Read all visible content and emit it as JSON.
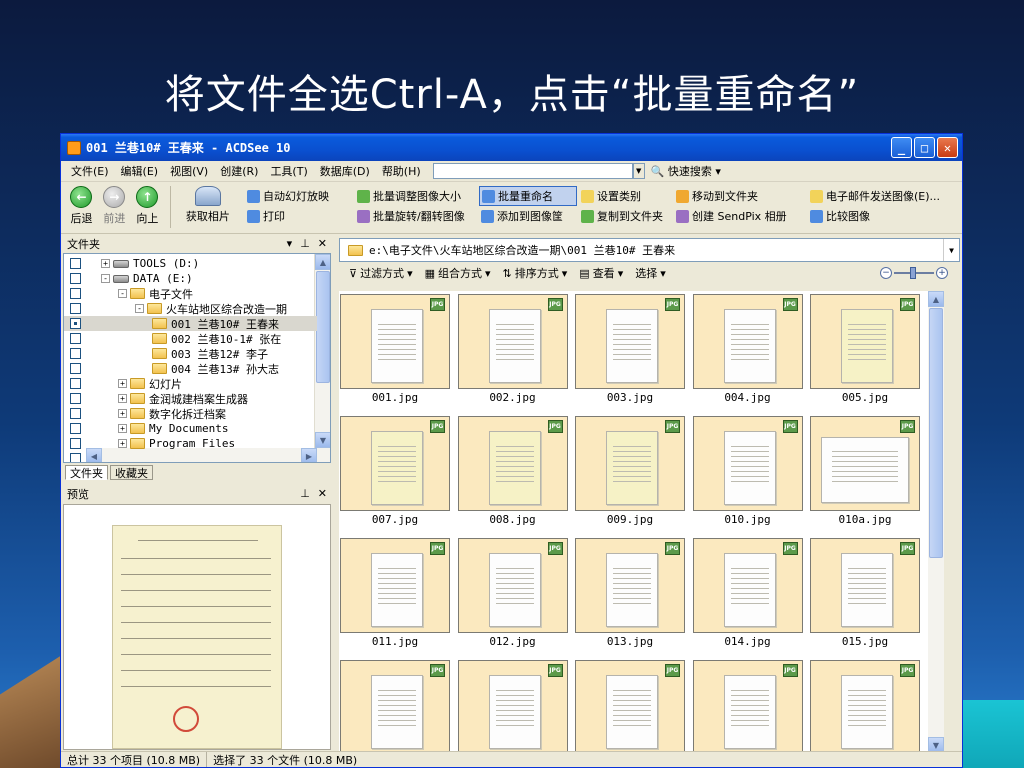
{
  "slide": {
    "title": "将文件全选Ctrl-A，点击“批量重命名”"
  },
  "window": {
    "title": "001 兰巷10# 王春来 - ACDSee 10"
  },
  "menu": [
    "文件(E)",
    "编辑(E)",
    "视图(V)",
    "创建(R)",
    "工具(T)",
    "数据库(D)",
    "帮助(H)"
  ],
  "menu_extra": {
    "quick_search": "快速搜索"
  },
  "toolbar": {
    "back": "后退",
    "forward": "前进",
    "up": "向上",
    "acquire": "获取相片",
    "tools": [
      {
        "label": "自动幻灯放映",
        "icon": "slideshow-icon"
      },
      {
        "label": "批量调整图像大小",
        "icon": "resize-icon"
      },
      {
        "label": "批量重命名",
        "icon": "rename-icon",
        "selected": true
      },
      {
        "label": "设置类别",
        "icon": "category-icon"
      },
      {
        "label": "移动到文件夹",
        "icon": "move-folder-icon"
      },
      {
        "label": "电子邮件发送图像(E)...",
        "icon": "email-icon"
      },
      {
        "label": "打印",
        "icon": "print-icon"
      },
      {
        "label": "批量旋转/翻转图像",
        "icon": "rotate-icon"
      },
      {
        "label": "添加到图像筐",
        "icon": "image-basket-icon"
      },
      {
        "label": "复制到文件夹",
        "icon": "copy-folder-icon"
      },
      {
        "label": "创建 SendPix 相册",
        "icon": "sendpix-icon"
      },
      {
        "label": "比较图像",
        "icon": "compare-icon"
      }
    ]
  },
  "folders_panel": {
    "title": "文件夹",
    "tree": [
      {
        "label": "TOOLS (D:)",
        "type": "drive",
        "exp": "+",
        "depth": 1
      },
      {
        "label": "DATA (E:)",
        "type": "drive",
        "exp": "-",
        "depth": 1
      },
      {
        "label": "电子文件",
        "type": "folder",
        "exp": "-",
        "depth": 2
      },
      {
        "label": "火车站地区综合改造一期",
        "type": "folder",
        "exp": "-",
        "depth": 3
      },
      {
        "label": "001 兰巷10# 王春来",
        "type": "folder",
        "exp": "",
        "depth": 4,
        "selected": true
      },
      {
        "label": "002 兰巷10-1# 张在",
        "type": "folder",
        "exp": "",
        "depth": 4
      },
      {
        "label": "003 兰巷12# 李子",
        "type": "folder",
        "exp": "",
        "depth": 4
      },
      {
        "label": "004 兰巷13# 孙大志",
        "type": "folder",
        "exp": "",
        "depth": 4
      },
      {
        "label": "幻灯片",
        "type": "folder",
        "exp": "+",
        "depth": 2
      },
      {
        "label": "金润城建档案生成器",
        "type": "folder",
        "exp": "+",
        "depth": 2
      },
      {
        "label": "数字化拆迁档案",
        "type": "folder",
        "exp": "+",
        "depth": 2
      },
      {
        "label": "My Documents",
        "type": "folder",
        "exp": "+",
        "depth": 2
      },
      {
        "label": "Program Files",
        "type": "folder",
        "exp": "+",
        "depth": 2
      }
    ],
    "tabs": [
      "文件夹",
      "收藏夹"
    ]
  },
  "preview_panel": {
    "title": "预览"
  },
  "browser": {
    "path": "e:\\电子文件\\火车站地区综合改造一期\\001 兰巷10# 王春来",
    "filter": "过滤方式",
    "group": "组合方式",
    "sort": "排序方式",
    "view": "查看",
    "select": "选择",
    "files": [
      "001.jpg",
      "002.jpg",
      "003.jpg",
      "004.jpg",
      "005.jpg",
      "007.jpg",
      "008.jpg",
      "009.jpg",
      "010.jpg",
      "010a.jpg",
      "011.jpg",
      "012.jpg",
      "013.jpg",
      "014.jpg",
      "015.jpg",
      "",
      "",
      "",
      "",
      ""
    ]
  },
  "status": {
    "total": "总计 33 个项目 (10.8 MB)",
    "selected": "选择了 33 个文件 (10.8 MB)"
  }
}
